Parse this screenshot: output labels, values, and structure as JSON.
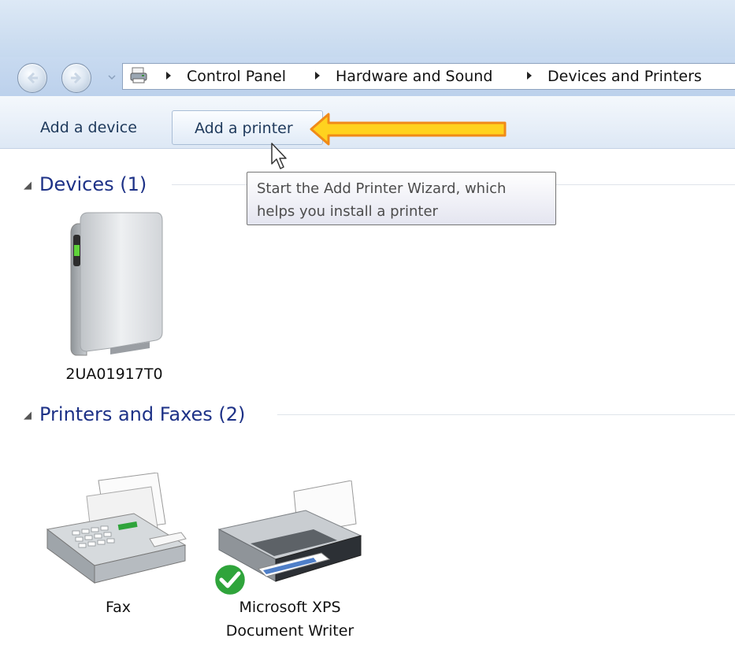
{
  "address_bar": {
    "breadcrumbs": [
      "Control Panel",
      "Hardware and Sound",
      "Devices and Printers"
    ],
    "icon": "devices-printers-icon"
  },
  "navigation": {
    "back_icon": "back-arrow-icon",
    "forward_icon": "forward-arrow-icon",
    "recent_icon": "chevron-down-icon"
  },
  "toolbar": {
    "add_device_label": "Add a device",
    "add_printer_label": "Add a printer"
  },
  "tooltip": {
    "line1": "Start the Add Printer Wizard, which",
    "line2": "helps you install a printer"
  },
  "groups": {
    "devices": {
      "header": "Devices (1)",
      "items": [
        {
          "label": "2UA01917T0",
          "icon": "external-drive-icon"
        }
      ]
    },
    "printers": {
      "header": "Printers and Faxes (2)",
      "items": [
        {
          "label": "Fax",
          "icon": "fax-icon"
        },
        {
          "label_line1": "Microsoft XPS",
          "label_line2": "Document Writer",
          "icon": "printer-icon",
          "status_icon": "default-checkmark-icon"
        }
      ]
    }
  },
  "colors": {
    "annotation_arrow": "#ffd21f",
    "annotation_arrow_border": "#f08a18",
    "group_header": "#1e3287",
    "default_check": "#2fa43b"
  }
}
